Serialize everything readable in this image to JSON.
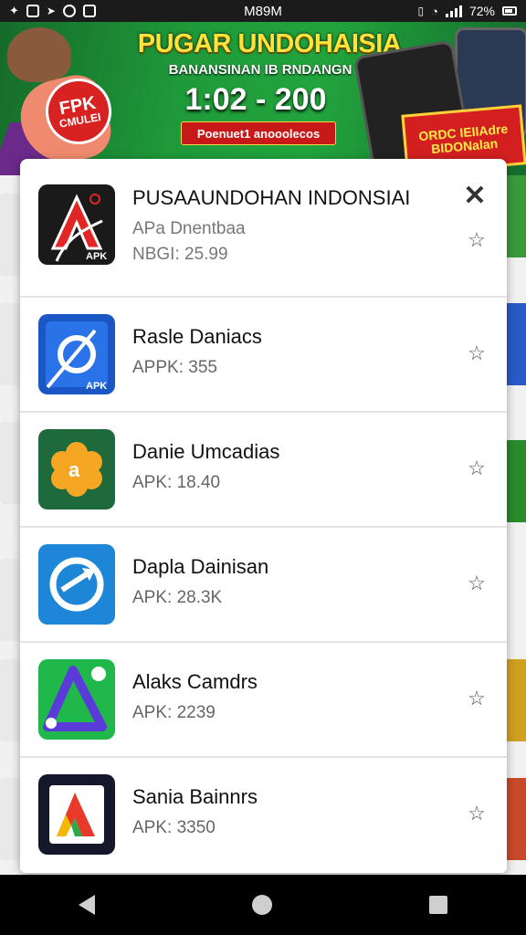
{
  "status_bar": {
    "time": "M89M",
    "battery": "72%"
  },
  "banner": {
    "title": "PUGAR UNDOHAISIA",
    "subtitle": "BANANSINAN IB RNDANGN",
    "big_text": "1:02 - 200",
    "button_label": "Poenuet1 anooolecos",
    "badge_line1": "FPK",
    "badge_line2": "CMULEI",
    "promo_text": "ORDC IEIIAdre BIDONalan"
  },
  "panel": {
    "close_label": "✕",
    "items": [
      {
        "name": "PUSAAUNDOHAN INDONSIAI",
        "line2": "APa Dnentbaa",
        "apk": "NBGI: 25.99",
        "icon": "red-a-apk-icon",
        "icon_bg": "#1a1a1a",
        "icon_label": "APK"
      },
      {
        "name": "Rasle Daniacs",
        "apk": "APPK: 355",
        "icon": "blue-link-apk-icon",
        "icon_bg": "#1a56c4",
        "icon_label": "APK"
      },
      {
        "name": "Danie Umcadias",
        "apk": "APK: 18.40",
        "icon": "orange-flower-icon",
        "icon_bg": "#1f6a3c",
        "icon_label": ""
      },
      {
        "name": "Dapla Dainisan",
        "apk": "APK: 28.3K",
        "icon": "blue-circle-arrow-icon",
        "icon_bg": "#1d86d6",
        "icon_label": ""
      },
      {
        "name": "Alaks Camdrs",
        "apk": "APK: 2239",
        "icon": "green-triangle-icon",
        "icon_bg": "#20b84a",
        "icon_label": ""
      },
      {
        "name": "Sania Bainnrs",
        "apk": "APK: 3350",
        "icon": "dark-color-a-icon",
        "icon_bg": "#15182a",
        "icon_label": ""
      }
    ]
  },
  "colors": {
    "banner_green": "#1f9a3a",
    "banner_yellow": "#ffe23a",
    "accent_red": "#c81919"
  }
}
